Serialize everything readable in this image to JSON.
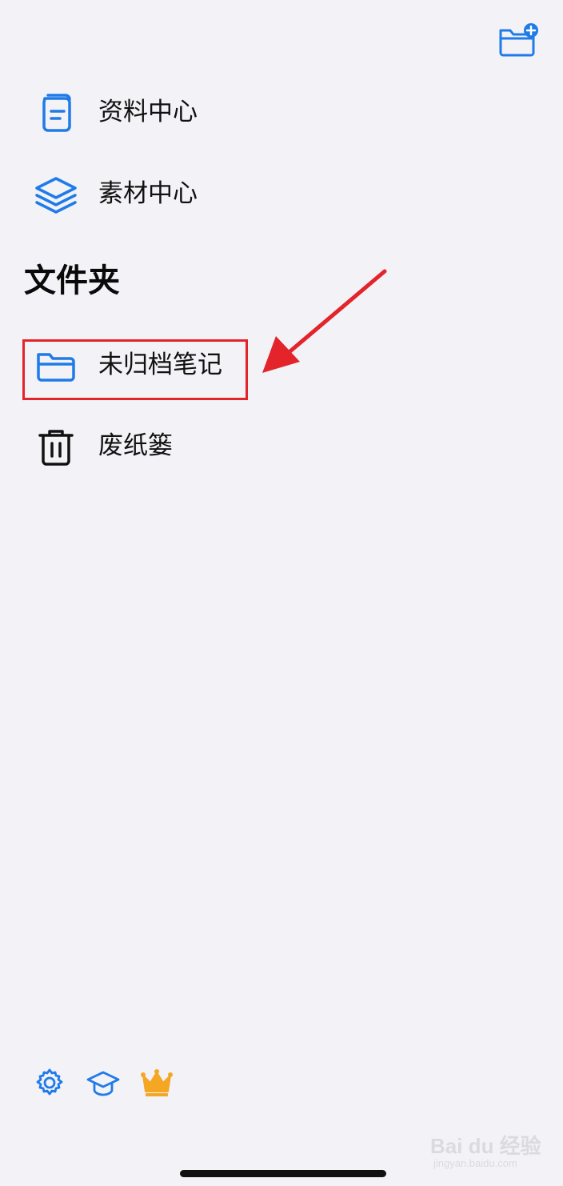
{
  "header": {
    "new_folder_icon": "folder-plus-icon"
  },
  "library": {
    "items": [
      {
        "label": "资料中心",
        "icon": "document-icon"
      },
      {
        "label": "素材中心",
        "icon": "layers-icon"
      }
    ]
  },
  "folders": {
    "title": "文件夹",
    "items": [
      {
        "label": "未归档笔记",
        "icon": "folder-icon"
      },
      {
        "label": "废纸篓",
        "icon": "trash-icon"
      }
    ]
  },
  "bottom_bar": {
    "icons": [
      "gear-icon",
      "graduation-cap-icon",
      "crown-icon"
    ]
  },
  "watermark": {
    "brand": "Bai du 经验",
    "url": "jingyan.baidu.com"
  },
  "colors": {
    "accent": "#1f7be8",
    "background": "#f2f2f7",
    "annotation": "#e3242b",
    "crown": "#f5a623"
  }
}
